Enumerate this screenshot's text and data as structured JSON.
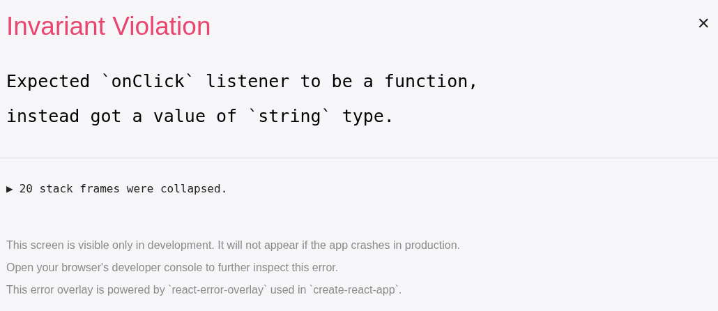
{
  "header": {
    "title": "Invariant Violation",
    "close": "×"
  },
  "message": [
    "Expected `onClick` listener to be a function,",
    "instead got a value of `string` type."
  ],
  "stack": {
    "toggle": "▶",
    "label": "20 stack frames were collapsed.",
    "expanded": false
  },
  "footer": [
    "This screen is visible only in development. It will not appear if the app crashes in production.",
    "Open your browser's developer console to further inspect this error.",
    "This error overlay is powered by `react-error-overlay` used in `create-react-app`."
  ]
}
